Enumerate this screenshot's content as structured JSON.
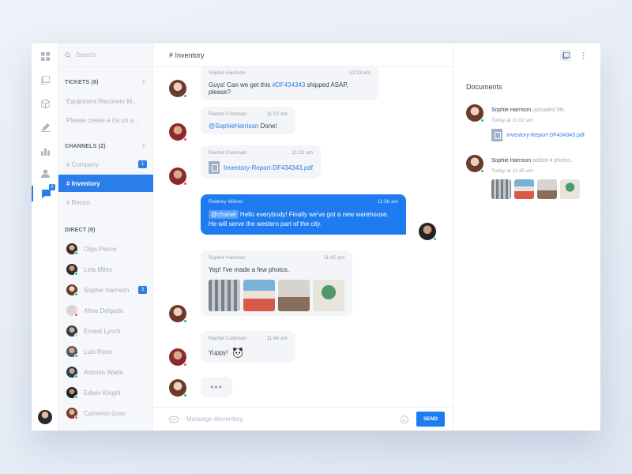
{
  "search": {
    "placeholder": "Search"
  },
  "sidebar": {
    "tickets_title": "TICKETS (8)",
    "tickets": [
      "Equipment Recovery M...",
      "Please create a r/a on a..."
    ],
    "channels_title": "CHANNELS (2)",
    "channels": [
      {
        "label": "# Company",
        "badge": "1"
      },
      {
        "label": "# Inventory",
        "badge": ""
      },
      {
        "label": "# Recon",
        "badge": ""
      }
    ],
    "direct_title": "DIRECT (9)",
    "direct": [
      {
        "name": "Olga Pierce",
        "status": "green"
      },
      {
        "name": "Lela Miles",
        "status": "green"
      },
      {
        "name": "Sophie Harrison",
        "status": "green",
        "badge": "3"
      },
      {
        "name": "Alma Delgado",
        "status": "pink"
      },
      {
        "name": "Ernest Lynch",
        "status": "grey"
      },
      {
        "name": "Luis Ross",
        "status": "green"
      },
      {
        "name": "Antonio Wade",
        "status": "green"
      },
      {
        "name": "Edwin Knight",
        "status": "green"
      },
      {
        "name": "Cameron Gray",
        "status": "pink"
      }
    ],
    "rail_badge": "2"
  },
  "main": {
    "channel_title": "# Inventory",
    "messages": [
      {
        "author": "Sophie Harrison",
        "time": "10:33 am",
        "text_pre": "Guys! Can we get this ",
        "link": "#DF434343",
        "text_post": " shipped ASAP, please?"
      },
      {
        "author": "Rachel Coleman",
        "time": "11:02 am",
        "mention": "@SophieHarrison",
        "text": " Done!"
      },
      {
        "author": "Rachel Coleman",
        "time": "11:02 am",
        "file": "Inventory-Report-DF434343.pdf"
      },
      {
        "author": "Rodney Wilson",
        "time": "11:36 am",
        "mention": "@chanel",
        "text": " Hello everybody! Finally we've got a new warehouse. He will serve the western part of the city."
      },
      {
        "author": "Sophie Harrison",
        "time": "11:45 am",
        "text": "Yep! I've made a few photos."
      },
      {
        "author": "Rachel Coleman",
        "time": "11:46 am",
        "text": "Yuppy!"
      }
    ],
    "typing": "•••",
    "composer_placeholder": "Message #inventory",
    "send_label": "SEND"
  },
  "documents": {
    "title": "Documents",
    "entries": [
      {
        "author": "Sophie Harrison",
        "action": " uploaded file.",
        "time": "Today at 11:02 am",
        "file": "Inventory-Report-DF434343.pdf"
      },
      {
        "author": "Sophie Harrison",
        "action": " added 4 photos.",
        "time": "Today at 11:45 am"
      }
    ]
  },
  "colors": {
    "accent": "#1f7cf0",
    "online": "#21c283",
    "busy": "#ef4b7b"
  }
}
